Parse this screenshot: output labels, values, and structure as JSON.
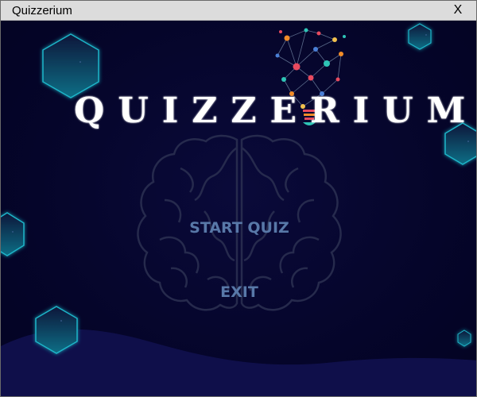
{
  "window": {
    "title": "Quizzerium",
    "close_label": "X"
  },
  "logo": {
    "text": "QUIZZERIUM"
  },
  "menu": {
    "start_label": "START QUIZ",
    "exit_label": "EXIT"
  },
  "colors": {
    "background": "#05052a",
    "hexagon_glow": "#1fb5c9",
    "menu_text": "#5878a8",
    "wave": "#0f0f4a"
  }
}
